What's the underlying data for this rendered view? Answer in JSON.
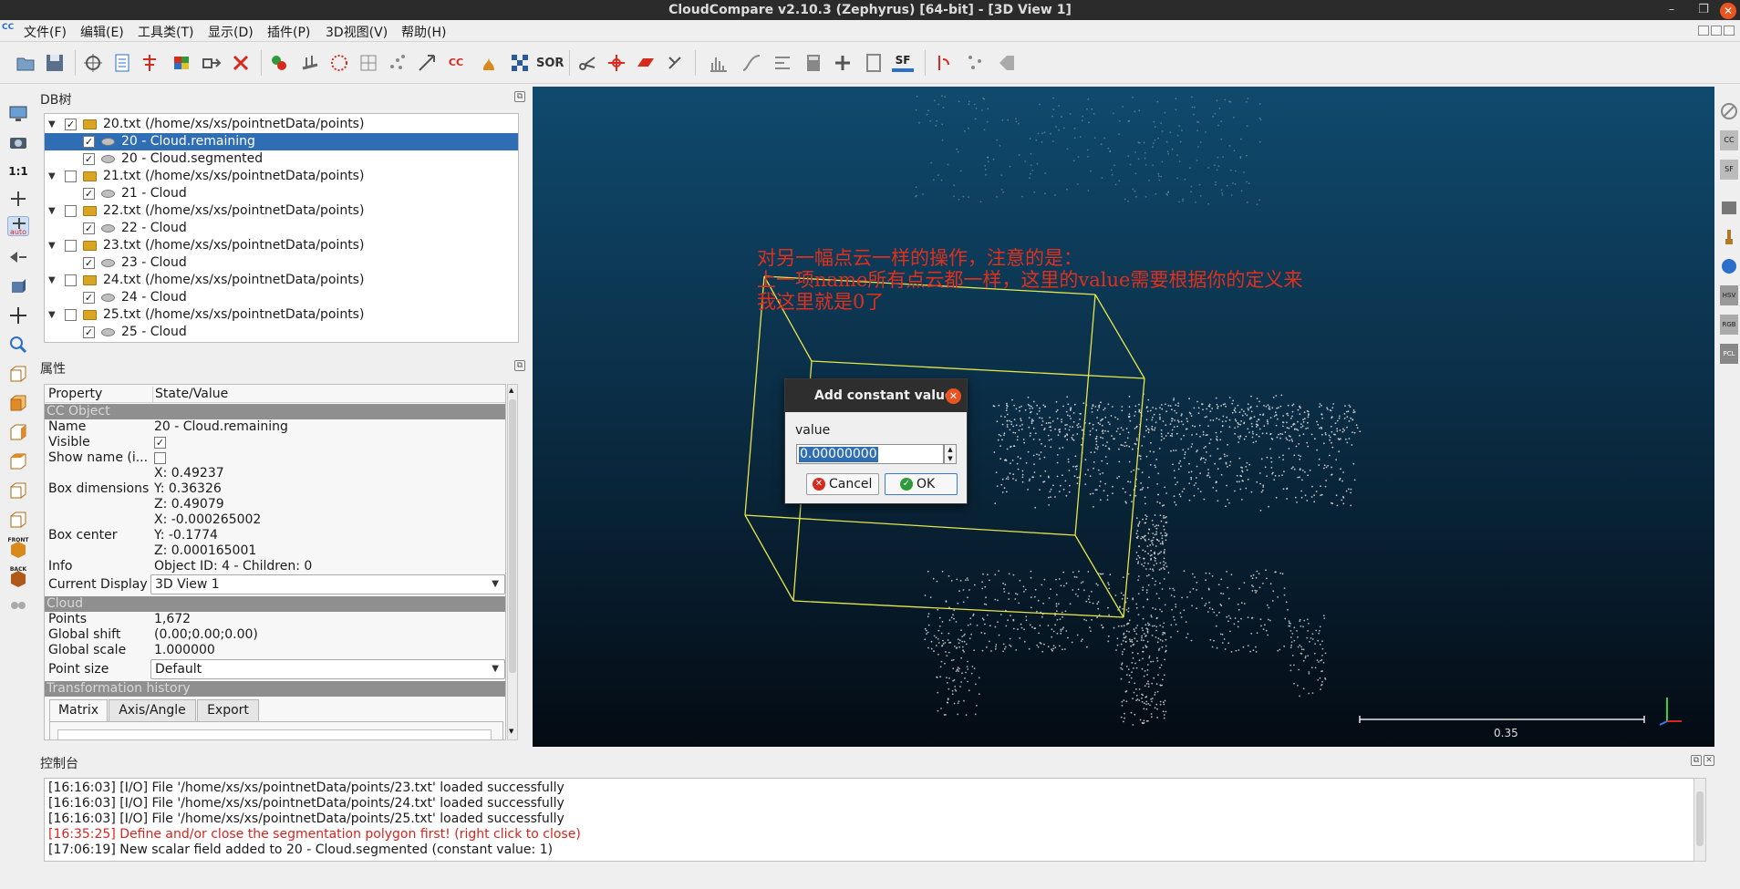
{
  "window": {
    "title": "CloudCompare v2.10.3 (Zephyrus) [64-bit] - [3D View 1]",
    "min_glyph": "–",
    "restore_glyph": "❐",
    "close_glyph": "✕"
  },
  "menubar": {
    "logo_glyph": "CC",
    "items": [
      "文件(F)",
      "编辑(E)",
      "工具类(T)",
      "显示(D)",
      "插件(P)",
      "3D视图(V)",
      "帮助(H)"
    ]
  },
  "toolbar": {
    "scale_button_label": "1:1",
    "icon_captions": {
      "cc": "CC",
      "sor": "SOR",
      "sf": "SF",
      "auto": "auto",
      "front": "FRONT",
      "back": "BACK",
      "cc_small": "CC",
      "sf_small": "SF",
      "hsv": "HSV",
      "rgb": "RGB",
      "pcl": "PCL"
    },
    "colors": {
      "red": "#d62a1e",
      "blue": "#2a6fc9",
      "green": "#2f9a3b",
      "orange": "#d98a1c",
      "gray": "#7a7a7a"
    }
  },
  "db_tree": {
    "title": "DB树",
    "float_glyph": "⧉",
    "check_glyph": "✓",
    "expand_glyph": "▼",
    "rows": [
      {
        "label": "20.txt (/home/xs/xs/pointnetData/points)",
        "level": 0,
        "checked": true,
        "type": "folder"
      },
      {
        "label": "20 - Cloud.remaining",
        "level": 1,
        "checked": true,
        "type": "cloud",
        "selected": true
      },
      {
        "label": "20 - Cloud.segmented",
        "level": 1,
        "checked": true,
        "type": "cloud"
      },
      {
        "label": "21.txt (/home/xs/xs/pointnetData/points)",
        "level": 0,
        "checked": false,
        "type": "folder"
      },
      {
        "label": "21 - Cloud",
        "level": 1,
        "checked": true,
        "type": "cloud"
      },
      {
        "label": "22.txt (/home/xs/xs/pointnetData/points)",
        "level": 0,
        "checked": false,
        "type": "folder"
      },
      {
        "label": "22 - Cloud",
        "level": 1,
        "checked": true,
        "type": "cloud"
      },
      {
        "label": "23.txt (/home/xs/xs/pointnetData/points)",
        "level": 0,
        "checked": false,
        "type": "folder"
      },
      {
        "label": "23 - Cloud",
        "level": 1,
        "checked": true,
        "type": "cloud"
      },
      {
        "label": "24.txt (/home/xs/xs/pointnetData/points)",
        "level": 0,
        "checked": false,
        "type": "folder"
      },
      {
        "label": "24 - Cloud",
        "level": 1,
        "checked": true,
        "type": "cloud"
      },
      {
        "label": "25.txt (/home/xs/xs/pointnetData/points)",
        "level": 0,
        "checked": false,
        "type": "folder"
      },
      {
        "label": "25 - Cloud",
        "level": 1,
        "checked": true,
        "type": "cloud"
      }
    ]
  },
  "properties": {
    "title": "属性",
    "header_property": "Property",
    "header_value": "State/Value",
    "sec_cc_object": "CC Object",
    "name_key": "Name",
    "name_val": "20 - Cloud.remaining",
    "visible_key": "Visible",
    "showname_key": "Show name (i...",
    "boxdim_key": "Box dimensions",
    "boxdim_x": "X: 0.49237",
    "boxdim_y": "Y: 0.36326",
    "boxdim_z": "Z: 0.49079",
    "boxcenter_key": "Box center",
    "boxcenter_x": "X: -0.000265002",
    "boxcenter_y": "Y: -0.1774",
    "boxcenter_z": "Z: 0.000165001",
    "info_key": "Info",
    "info_val": "Object ID: 4 - Children: 0",
    "display_key": "Current Display",
    "display_val": "3D View 1",
    "sec_cloud": "Cloud",
    "points_key": "Points",
    "points_val": "1,672",
    "gshift_key": "Global shift",
    "gshift_val": "(0.00;0.00;0.00)",
    "gscale_key": "Global scale",
    "gscale_val": "1.000000",
    "psize_key": "Point size",
    "psize_val": "Default",
    "sec_transform": "Transformation history",
    "tabs": [
      "Matrix",
      "Axis/Angle",
      "Export"
    ],
    "dd_glyph": "▼"
  },
  "view3d": {
    "annotation_line1": "对另一幅点云一样的操作，注意的是：",
    "annotation_line2": "上一项name所有点云都一样，这里的value需要根据你的定义来",
    "annotation_line3": "我这里就是0了",
    "scale_label": "0.35",
    "colors": {
      "box": "#e6e64a",
      "points": "#d8d8d8",
      "annotation": "#e0301c"
    }
  },
  "dialog": {
    "title": "Add constant value",
    "close_glyph": "✕",
    "field_label": "value",
    "value": "0.00000000",
    "spin_up": "▲",
    "spin_down": "▼",
    "cancel_label": "Cancel",
    "ok_label": "OK",
    "cancel_glyph": "✕",
    "ok_glyph": "✓"
  },
  "console": {
    "title": "控制台",
    "lines": [
      {
        "text": "[16:16:03] [I/O] File '/home/xs/xs/pointnetData/points/23.txt' loaded successfully",
        "error": false
      },
      {
        "text": "[16:16:03] [I/O] File '/home/xs/xs/pointnetData/points/24.txt' loaded successfully",
        "error": false
      },
      {
        "text": "[16:16:03] [I/O] File '/home/xs/xs/pointnetData/points/25.txt' loaded successfully",
        "error": false
      },
      {
        "text": "[16:35:25] Define and/or close the segmentation polygon first! (right click to close)",
        "error": true
      },
      {
        "text": "[17:06:19] New scalar field added to 20 - Cloud.segmented (constant value: 1)",
        "error": false
      }
    ]
  }
}
